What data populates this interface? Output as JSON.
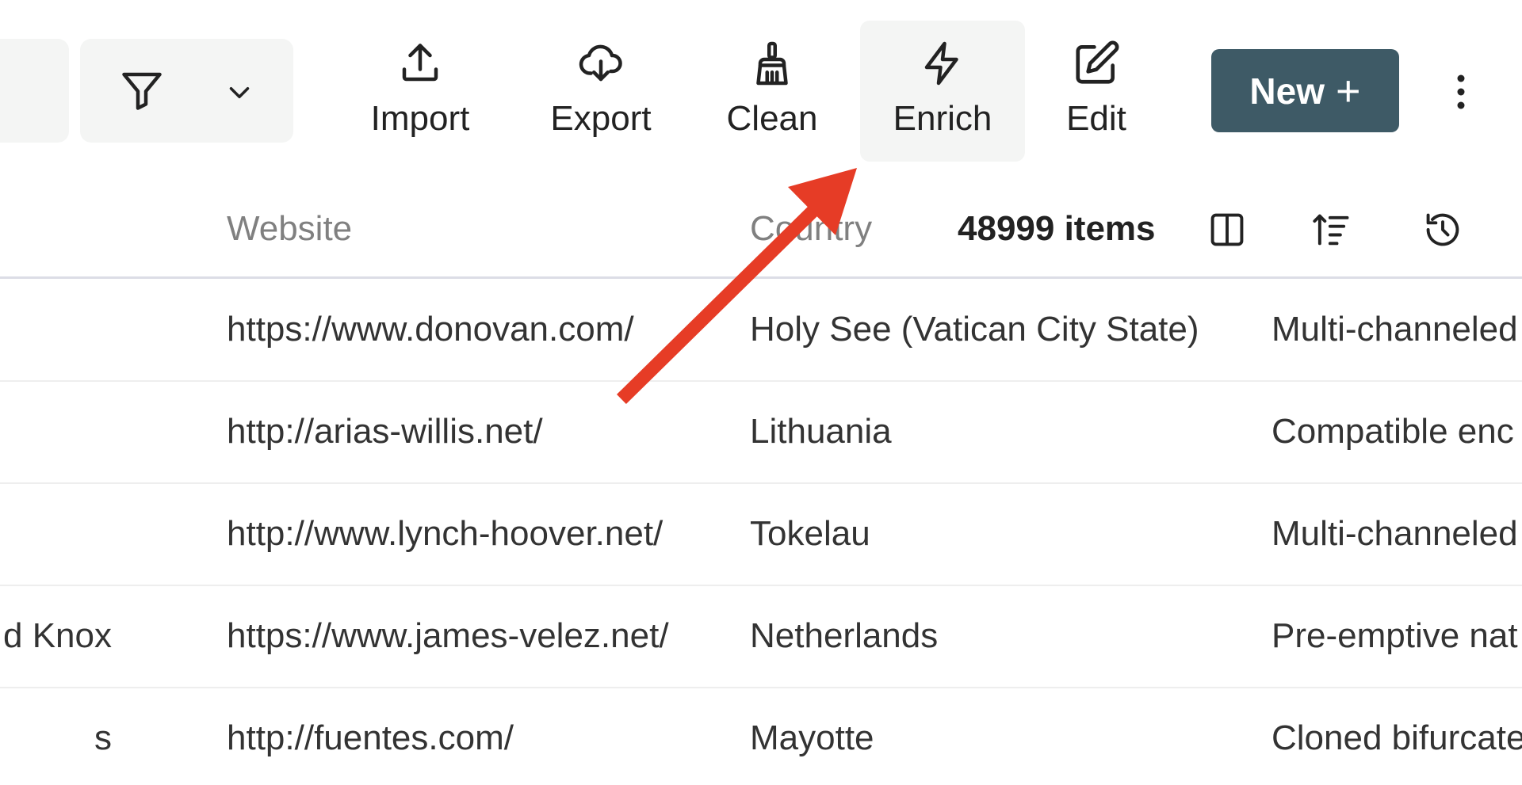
{
  "toolbar": {
    "filter_icon": "filter-icon",
    "filter_chevron_icon": "chevron-down-icon",
    "buttons": [
      {
        "label": "Import",
        "icon": "upload-icon"
      },
      {
        "label": "Export",
        "icon": "cloud-download-icon"
      },
      {
        "label": "Clean",
        "icon": "broom-icon"
      },
      {
        "label": "Enrich",
        "icon": "lightning-icon"
      },
      {
        "label": "Edit",
        "icon": "edit-icon"
      }
    ],
    "new_button": {
      "label": "New",
      "plus": "+",
      "color": "#3e5a66"
    },
    "more_icon": "more-vertical-icon"
  },
  "table": {
    "columns": [
      "Website",
      "Country"
    ],
    "items_count": "48999 items",
    "header_icons": [
      "columns-icon",
      "sort-icon",
      "history-icon"
    ],
    "rows": [
      {
        "name": "",
        "website": "https://www.donovan.com/",
        "country": "Holy See (Vatican City State)",
        "description": "Multi-channeled"
      },
      {
        "name": "",
        "website": "http://arias-willis.net/",
        "country": "Lithuania",
        "description": "Compatible enc"
      },
      {
        "name": "",
        "website": "http://www.lynch-hoover.net/",
        "country": "Tokelau",
        "description": "Multi-channeled"
      },
      {
        "name": "d Knox",
        "website": "https://www.james-velez.net/",
        "country": "Netherlands",
        "description": "Pre-emptive nat"
      },
      {
        "name": "s",
        "website": "http://fuentes.com/",
        "country": "Mayotte",
        "description": "Cloned bifurcate"
      }
    ]
  },
  "annotation": {
    "arrow_color": "#e63c26"
  }
}
